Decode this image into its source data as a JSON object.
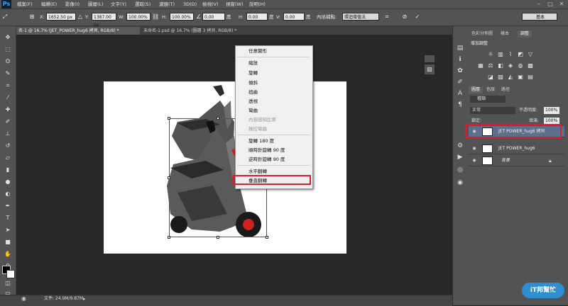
{
  "app": {
    "logo": "Ps"
  },
  "menubar": {
    "items": [
      "檔案(F)",
      "編輯(E)",
      "影像(I)",
      "圖層(L)",
      "文字(Y)",
      "選取(S)",
      "濾鏡(T)",
      "3D(D)",
      "檢視(V)",
      "視窗(W)",
      "說明(H)"
    ],
    "window_buttons": [
      "–",
      "□",
      "✕"
    ]
  },
  "options": {
    "x_label": "X:",
    "x_value": "1652.50 px",
    "y_label": "Y:",
    "y_value": "1387.00 px",
    "w_label": "W:",
    "w_value": "100.00%",
    "h_label": "H:",
    "h_value": "100.00%",
    "angle_value": "0.00",
    "angle_unit": "度",
    "hskew_label": "H:",
    "hskew_value": "0.00",
    "hskew_unit": "度",
    "vskew_label": "V:",
    "vskew_value": "0.00",
    "vskew_unit": "度",
    "interp_label": "內插補點:",
    "interp_value": "環迴增值法",
    "workspace_value": "基本"
  },
  "tabs": {
    "active": "名-1 @ 16.7% (JET_POWER_hug6 拷貝, RGB/8) *",
    "inactive": "未命名-1.psd @ 16.7% (圖層 3 拷貝, RGB/8) *"
  },
  "context_menu": {
    "items": [
      {
        "label": "任意變形",
        "disabled": false
      },
      {
        "label": "縮放",
        "disabled": false
      },
      {
        "label": "旋轉",
        "disabled": false
      },
      {
        "label": "傾斜",
        "disabled": false
      },
      {
        "label": "扭曲",
        "disabled": false
      },
      {
        "label": "透視",
        "disabled": false
      },
      {
        "label": "彎曲",
        "disabled": false
      },
      {
        "label": "內容感知比率",
        "disabled": true
      },
      {
        "label": "操控彎曲",
        "disabled": true
      },
      {
        "label": "旋轉 180 度",
        "disabled": false
      },
      {
        "label": "順時針旋轉 90 度",
        "disabled": false
      },
      {
        "label": "逆時針旋轉 90 度",
        "disabled": false
      },
      {
        "label": "水平翻轉",
        "disabled": false
      },
      {
        "label": "垂直翻轉",
        "disabled": false
      }
    ],
    "highlighted": "垂直翻轉"
  },
  "status": {
    "doc_size": "文件: 24.9M/9.87M"
  },
  "panels": {
    "top_tabs": [
      "色彩分佈圖",
      "樣本",
      "調整"
    ],
    "adjust_title": "增加調整",
    "layers_tabs": [
      "圖層",
      "色版",
      "路徑"
    ],
    "kind_label": "種類",
    "blend_mode": "正常",
    "opacity_label": "不透明度:",
    "opacity_value": "100%",
    "lock_label": "鎖定:",
    "fill_label": "填滿:",
    "fill_value": "100%",
    "layers": [
      {
        "name": "JET POWER_hug6 拷貝",
        "selected": true
      },
      {
        "name": "JET POWER_hug6",
        "selected": false
      },
      {
        "name": "背景",
        "selected": false,
        "locked": true
      }
    ]
  },
  "watermark": {
    "text": "iT邦幫忙"
  },
  "colors": {
    "highlight_red": "#e01b2c",
    "selected_layer": "#5d6f8c"
  }
}
